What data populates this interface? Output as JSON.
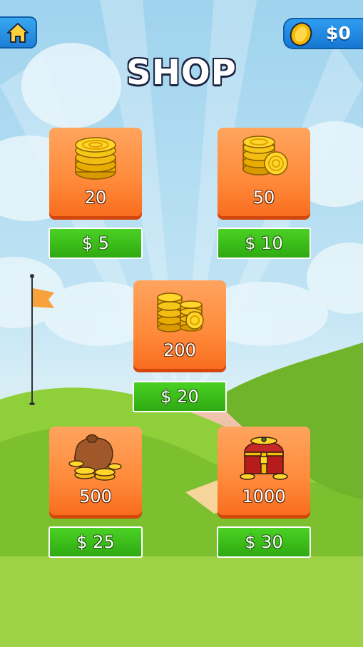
{
  "header": {
    "home_icon": "home-icon",
    "coin_icon": "coin-icon",
    "coin_balance": "$0",
    "title": "SHOP"
  },
  "packs": [
    {
      "amount": "20",
      "price": "$ 5",
      "art": "coin-stack-icon"
    },
    {
      "amount": "50",
      "price": "$ 10",
      "art": "double-coin-stack-icon"
    },
    {
      "amount": "200",
      "price": "$ 20",
      "art": "coin-pile-icon"
    },
    {
      "amount": "500",
      "price": "$ 25",
      "art": "coin-bag-icon"
    },
    {
      "amount": "1000",
      "price": "$ 30",
      "art": "treasure-chest-icon"
    }
  ],
  "colors": {
    "card": "#ff8a3a",
    "price_button": "#3cc01a",
    "hud_blue": "#1d7fd6"
  }
}
